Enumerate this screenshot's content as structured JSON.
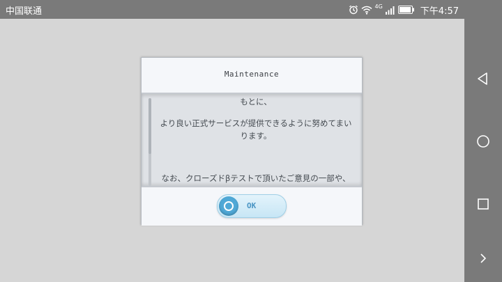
{
  "status_bar": {
    "carrier": "中国联通",
    "network_type": "4G",
    "time": "下午4:57",
    "icons": [
      "alarm-icon",
      "wifi-icon",
      "signal-icon",
      "battery-icon"
    ]
  },
  "nav_bar": {
    "buttons": [
      "back-icon",
      "home-icon",
      "recents-icon",
      "expand-icon"
    ]
  },
  "dialog": {
    "title": "Maintenance",
    "body_lines": [
      "もとに、",
      "より良い正式サービスが提供できるように努めてまい",
      "ります。",
      "なお、クローズドβテストで頂いたご意見の一部や、"
    ],
    "ok_label": "OK"
  },
  "colors": {
    "status_bar_bg": "#7a7a7a",
    "background": "#d6d6d6",
    "button_accent": "#4fa8d6"
  }
}
